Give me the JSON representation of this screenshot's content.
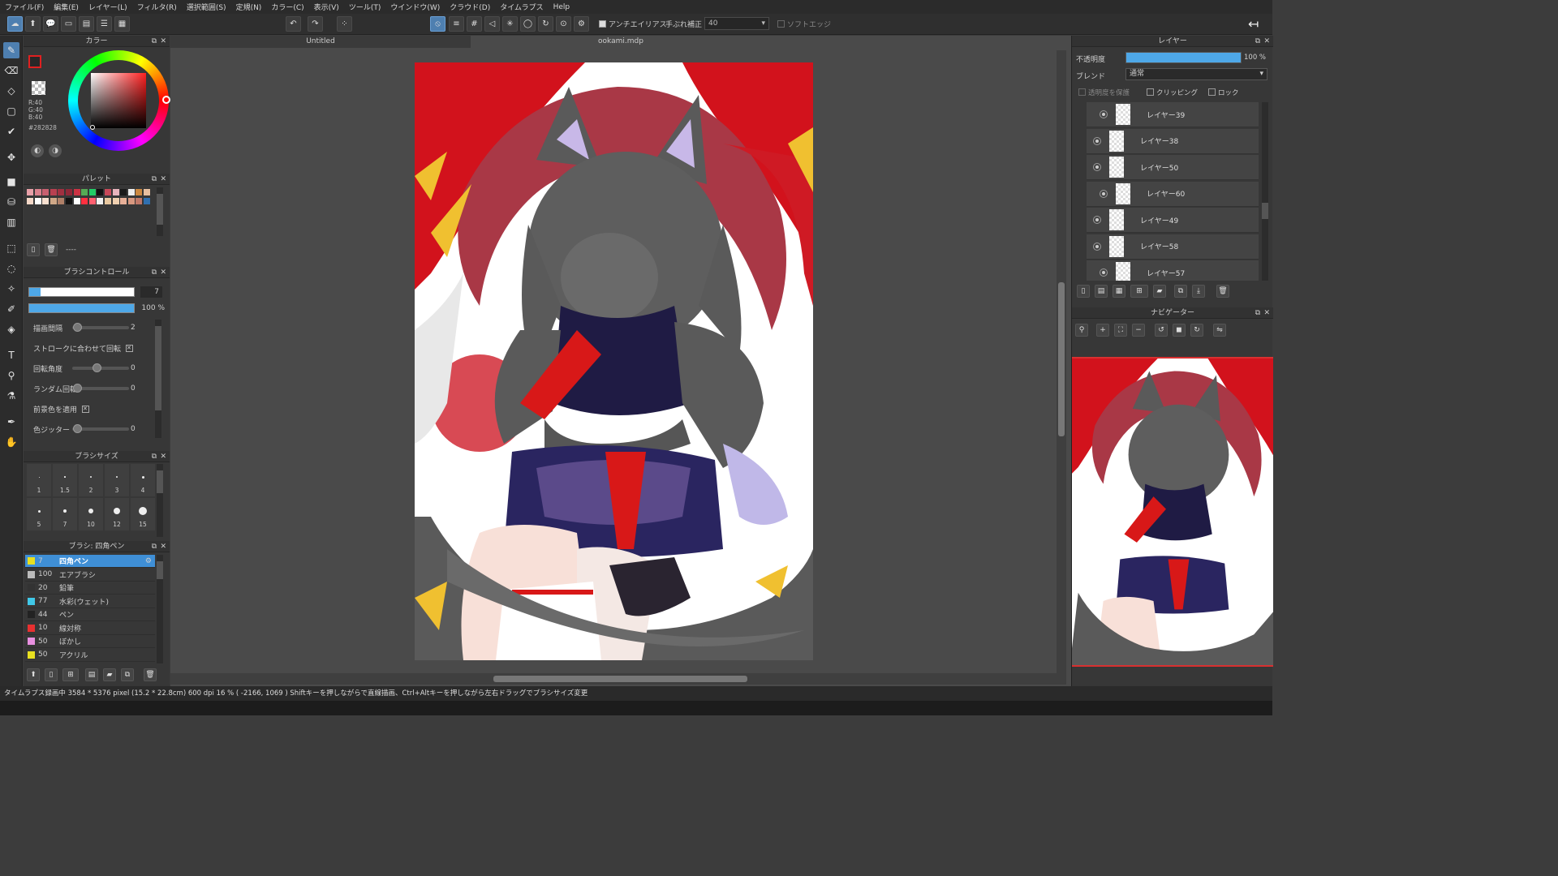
{
  "menu": [
    "ファイル(F)",
    "編集(E)",
    "レイヤー(L)",
    "フィルタ(R)",
    "選択範囲(S)",
    "定規(N)",
    "カラー(C)",
    "表示(V)",
    "ツール(T)",
    "ウインドウ(W)",
    "クラウド(D)",
    "タイムラプス",
    "Help"
  ],
  "toolbar": {
    "antialias_label": "アンチエイリアス",
    "stabilizer_label": "手ぶれ補正",
    "stabilizer_value": "40",
    "soft_edge_label": "ソフトエッジ"
  },
  "color_panel": {
    "title": "カラー",
    "r": "R:40",
    "g": "G:40",
    "b": "B:40",
    "hex": "#282828"
  },
  "palette_panel": {
    "title": "パレット",
    "name": "----",
    "swatches": [
      "#e8a0a8",
      "#d9808c",
      "#c86070",
      "#b84050",
      "#a03040",
      "#902838",
      "#cc3344",
      "#55aa55",
      "#22cc66",
      "#111111",
      "#c84858",
      "#e8b4bc",
      "#1a1a1a",
      "#eeeeee",
      "#cc8840",
      "#e8c0a0",
      "#f4d8c8",
      "#ffffff",
      "#f8e0d0",
      "#d0a888",
      "#b08068",
      "#111111",
      "#ffffff",
      "#ff3040",
      "#ff6070",
      "#f0f0f0",
      "#e8c8a0",
      "#f0d0b0",
      "#e8b098",
      "#d89880",
      "#c07868",
      "#3070b0"
    ]
  },
  "brush_control": {
    "title": "ブラシコントロール",
    "size_value": "7",
    "opacity_value": "100 %",
    "rows": [
      {
        "label": "描画間隔",
        "value": "2",
        "type": "slider"
      },
      {
        "label": "ストロークに合わせて回転",
        "value": "",
        "type": "checkbox"
      },
      {
        "label": "回転角度",
        "value": "0",
        "type": "slider"
      },
      {
        "label": "ランダム回転",
        "value": "0",
        "type": "slider"
      },
      {
        "label": "前景色を適用",
        "value": "",
        "type": "checkbox"
      },
      {
        "label": "色ジッター",
        "value": "0",
        "type": "slider"
      }
    ]
  },
  "brush_size": {
    "title": "ブラシサイズ",
    "row1": [
      "1",
      "1.5",
      "2",
      "3",
      "4"
    ],
    "row2": [
      "5",
      "7",
      "10",
      "12",
      "15"
    ]
  },
  "brush_list": {
    "title": "ブラシ: 四角ペン",
    "items": [
      {
        "color": "#e8e020",
        "num": "7",
        "name": "四角ペン",
        "selected": true
      },
      {
        "color": "#bbbbbb",
        "num": "100",
        "name": "エアブラシ",
        "selected": false
      },
      {
        "color": "#333333",
        "num": "20",
        "name": "鉛筆",
        "selected": false
      },
      {
        "color": "#40c8e8",
        "num": "77",
        "name": "水彩(ウェット)",
        "selected": false
      },
      {
        "color": "#222222",
        "num": "44",
        "name": "ペン",
        "selected": false
      },
      {
        "color": "#e83030",
        "num": "10",
        "name": "線対称",
        "selected": false
      },
      {
        "color": "#e890e0",
        "num": "50",
        "name": "ぼかし",
        "selected": false
      },
      {
        "color": "#e8e020",
        "num": "50",
        "name": "アクリル",
        "selected": false
      }
    ]
  },
  "canvas": {
    "tab_untitled": "Untitled",
    "tab_file": "ookami.mdp"
  },
  "layer_panel": {
    "title": "レイヤー",
    "opacity_label": "不透明度",
    "opacity_value": "100 %",
    "opacity_fraction": 1.0,
    "blend_label": "ブレンド",
    "blend_value": "通常",
    "protect_label": "透明度を保護",
    "clipping_label": "クリッピング",
    "lock_label": "ロック",
    "layers": [
      {
        "name": "レイヤー39",
        "indent": true
      },
      {
        "name": "レイヤー38",
        "indent": false
      },
      {
        "name": "レイヤー50",
        "indent": false
      },
      {
        "name": "レイヤー60",
        "indent": true
      },
      {
        "name": "レイヤー49",
        "indent": false
      },
      {
        "name": "レイヤー58",
        "indent": false
      },
      {
        "name": "レイヤー57",
        "indent": true
      }
    ]
  },
  "navigator": {
    "title": "ナビゲーター"
  },
  "status": {
    "text": "タイムラプス録画中  3584 * 5376 pixel  (15.2 * 22.8cm)  600 dpi  16 %  ( -2166, 1069 )  Shiftキーを押しながらで直線描画、Ctrl+Altキーを押しながら左右ドラッグでブラシサイズ変更"
  },
  "colors": {
    "accent": "#4e7fb0",
    "selection": "#3f8fd6",
    "foreground": "#282828"
  }
}
